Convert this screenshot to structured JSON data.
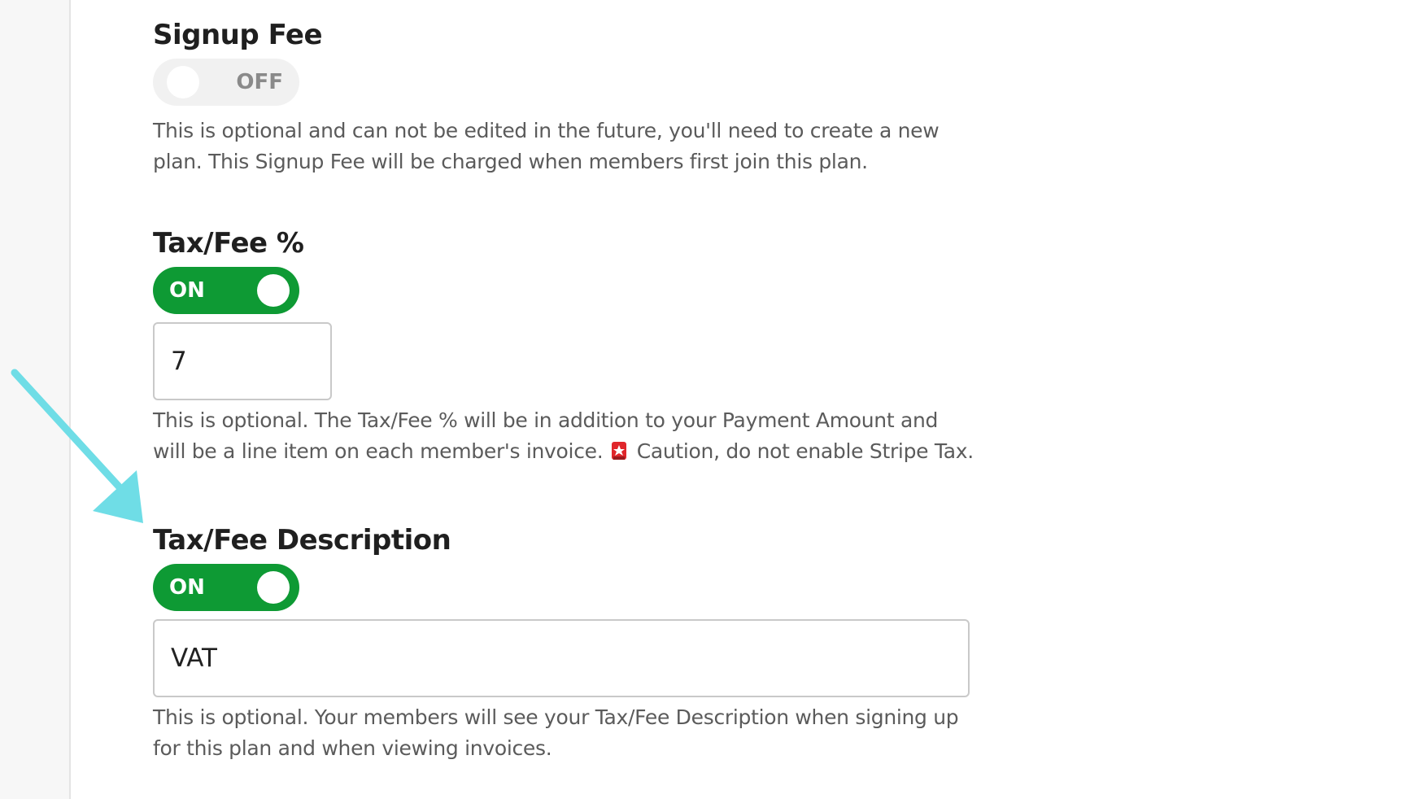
{
  "signup_fee": {
    "title": "Signup Fee",
    "toggle_label": "OFF",
    "toggle_state": "off",
    "help": "This is optional and can not be edited in the future, you'll need to create a new plan. This Signup Fee will be charged when members first join this plan."
  },
  "tax_fee_percent": {
    "title": "Tax/Fee %",
    "toggle_label": "ON",
    "toggle_state": "on",
    "value": "7",
    "help_prefix": "This is optional. The Tax/Fee % will be in addition to your Payment Amount and will be a line item on each member's invoice.",
    "help_caution": "Caution, do not enable Stripe Tax.",
    "caution_icon": "siren-icon"
  },
  "tax_fee_description": {
    "title": "Tax/Fee Description",
    "toggle_label": "ON",
    "toggle_state": "on",
    "value": "VAT",
    "help": "This is optional. Your members will see your Tax/Fee Description when signing up for this plan and when viewing invoices."
  },
  "annotation": {
    "arrow_color": "#6fdde6"
  },
  "colors": {
    "toggle_on": "#0e9a34",
    "toggle_off": "#f1f1f1"
  }
}
